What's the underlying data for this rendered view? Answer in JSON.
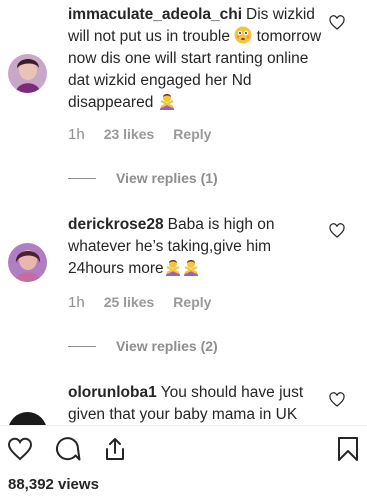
{
  "comments": [
    {
      "username": "immaculate_adeola_chi",
      "text_a": "Dis wizkid will not put us in trouble ",
      "text_b": " tomorrow now dis one will start ranting online dat wizkid engaged her Nd disappeared ",
      "emojis": [
        "flushed-face-emoji",
        "person-gesturing-no-emoji"
      ],
      "time": "1h",
      "likes": "23 likes",
      "reply": "Reply",
      "view_replies": "View replies (1)"
    },
    {
      "username": "derickrose28",
      "text_a": "Baba is high on whatever he’s taking,give him 24hours more",
      "emojis": [
        "person-gesturing-no-emoji",
        "person-gesturing-no-emoji"
      ],
      "time": "1h",
      "likes": "25 likes",
      "reply": "Reply",
      "view_replies": "View replies (2)"
    },
    {
      "username": "olorunloba1",
      "text_a": "You should have just given that your baby mama in UK"
    }
  ],
  "actions": {
    "icons": [
      "heart-icon",
      "comment-icon",
      "share-icon",
      "bookmark-icon"
    ]
  },
  "views": "88,392 views",
  "colors": {
    "text": "#262626",
    "muted": "#8e8e8e",
    "emoji": "#f5c43b",
    "person": "#9b5fc0"
  }
}
